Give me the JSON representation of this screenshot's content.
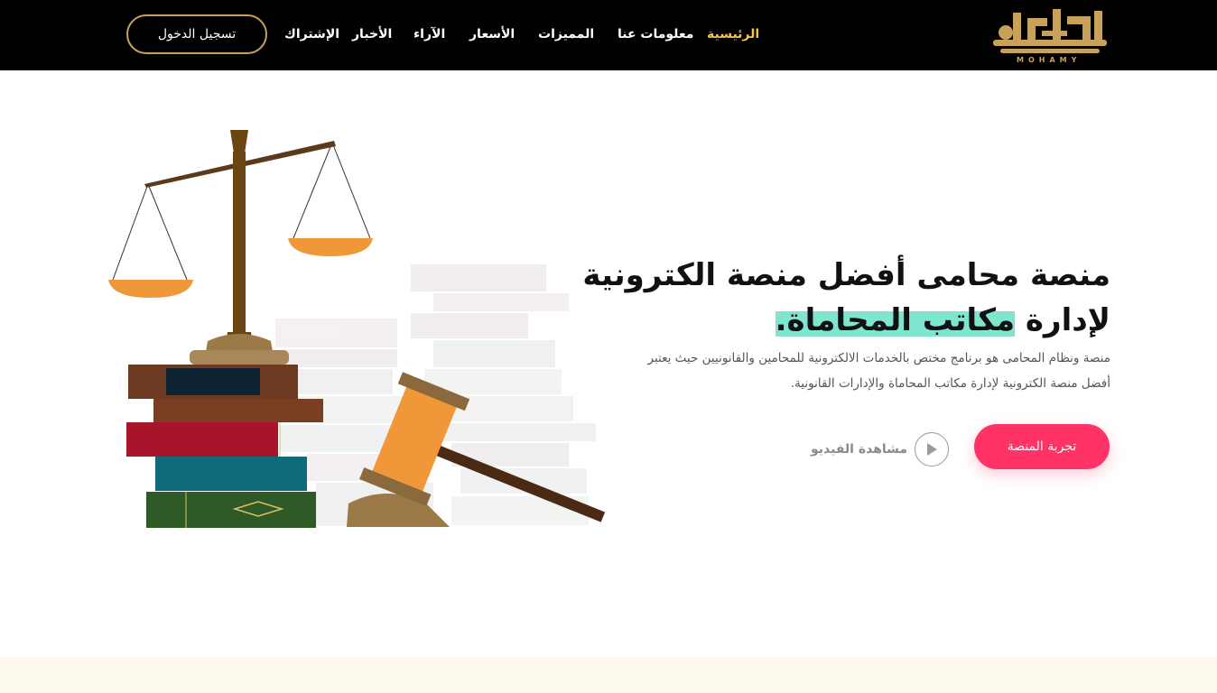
{
  "header": {
    "brand_latin": "MOHAMY",
    "nav": [
      {
        "label": "الرئيسية",
        "active": true
      },
      {
        "label": "معلومات عنا"
      },
      {
        "label": "المميزات"
      },
      {
        "label": "الأسعار"
      },
      {
        "label": "الآراء"
      },
      {
        "label": "الأخبار"
      },
      {
        "label": "الإشتراك"
      }
    ],
    "login_label": "تسجيل الدخول"
  },
  "hero": {
    "title_line1": "منصة محامى أفضل منصة الكترونية",
    "title_line2_prefix": "لإدارة ",
    "title_line2_highlight": "مكاتب المحاماة.",
    "description": "منصة ونظام المحامى هو برنامج مختص بالخدمات الالكترونية للمحامين والقانونيين حيث يعتبر أفضل منصة الكترونية لإدارة مكاتب المحاماة والإدارات القانونية.",
    "cta_label": "تجربة المنصة",
    "video_label": "مشاهدة الفيديو"
  },
  "icons": {
    "logo": "mohamy-logo",
    "play": "play-icon",
    "illustration": "scales-books-gavel-illustration"
  },
  "colors": {
    "header_bg": "#000000",
    "gold": "#c8a15a",
    "active_nav": "#f2c34a",
    "cta": "#ff3366",
    "highlight": "#7fe5cf",
    "orange": "#f0973a"
  }
}
